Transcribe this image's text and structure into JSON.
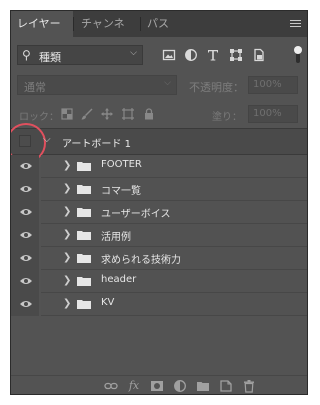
{
  "tabs": [
    {
      "label": "レイヤー",
      "active": true
    },
    {
      "label": "チャンネル",
      "active": false
    },
    {
      "label": "パス",
      "active": false
    }
  ],
  "filter": {
    "kind_label": "種類"
  },
  "blend": {
    "mode_label": "通常",
    "opacity_label": "不透明度：",
    "opacity_value": "100%"
  },
  "lock": {
    "label": "ロック：",
    "fill_label": "塗り：",
    "fill_value": "100%"
  },
  "artboard": {
    "name": "アートボード 1"
  },
  "layers": [
    {
      "name": "FOOTER"
    },
    {
      "name": "コマ一覧"
    },
    {
      "name": "ユーザーボイス"
    },
    {
      "name": "活用例"
    },
    {
      "name": "求められる技術力"
    },
    {
      "name": "header"
    },
    {
      "name": "KV"
    }
  ],
  "colors": {
    "panel": "#535353",
    "tabbar": "#3d3d3d",
    "highlight": "#e0505e"
  }
}
